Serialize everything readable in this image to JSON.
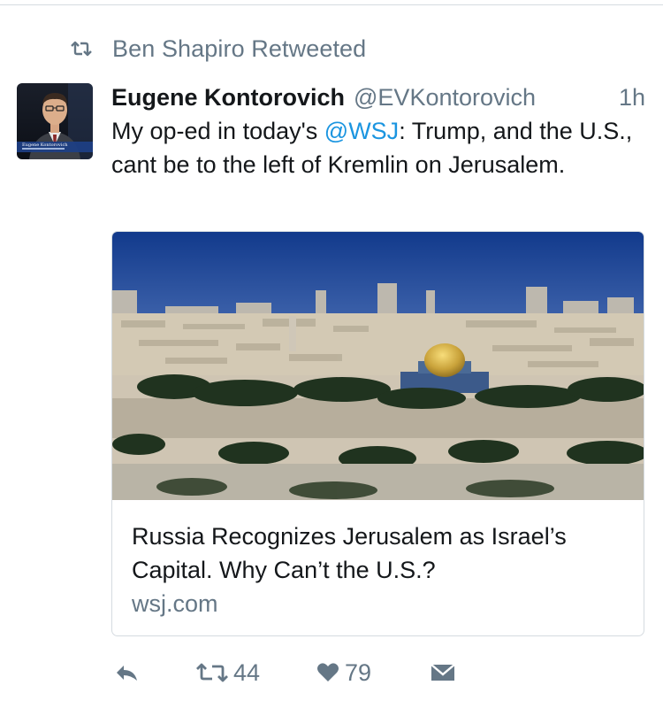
{
  "retweet_context": {
    "icon": "retweet-icon",
    "text": "Ben Shapiro Retweeted"
  },
  "tweet": {
    "author_name": "Eugene Kontorovich",
    "author_handle": "@EVKontorovich",
    "time_ago": "1h",
    "avatar_caption": "Eugene Kontorovich",
    "text_before_mention": "My op-ed in today's ",
    "mention": "@WSJ",
    "text_after_mention": ": Trump, and the U.S., cant be to the left of Kremlin on Jerusalem."
  },
  "card": {
    "title": "Russia Recognizes Jerusalem as Israel’s Capital. Why Can’t the U.S.?",
    "domain": "wsj.com"
  },
  "actions": {
    "reply": {
      "icon": "reply-icon"
    },
    "retweet": {
      "icon": "retweet-icon",
      "count": "44"
    },
    "like": {
      "icon": "heart-icon",
      "count": "79"
    },
    "dm": {
      "icon": "direct-message-icon"
    }
  },
  "colors": {
    "link": "#1b95e0",
    "secondary_text": "#657786",
    "border": "#d5dbe0",
    "text": "#14171a"
  }
}
